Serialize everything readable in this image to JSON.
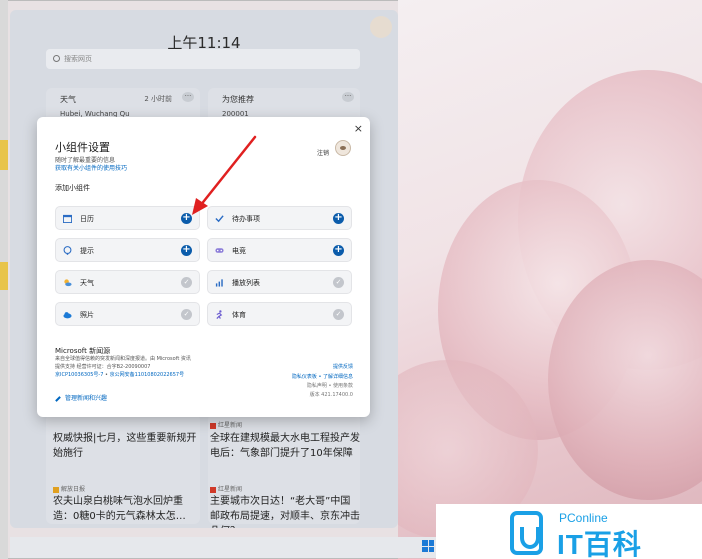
{
  "panel": {
    "clock": "上午11:14",
    "search_placeholder": "搜索网页",
    "weather_card": {
      "title": "天气",
      "meta": "2 小时前",
      "location": "Hubei, Wuchang Qu"
    },
    "recommend_card": {
      "title": "为您推荐",
      "meta": "200001"
    },
    "news": [
      {
        "text": "权威快报|七月，这些重要新规开始施行",
        "source": ""
      },
      {
        "source": "红星新闻",
        "text": "全球在建规模最大水电工程投产发电后：气象部门提升了10年保障"
      },
      {
        "source": "解放日报",
        "text": "农夫山泉白桃味气泡水回炉重造：0糖0卡的元气森林太怎…"
      },
      {
        "source": "红星新闻",
        "text": "主要城市次日达！“老大哥”中国邮政布局提速，对顺丰、京东冲击几何？"
      }
    ]
  },
  "dialog": {
    "title": "小组件设置",
    "description": "随时了解最重要的信息",
    "tips_link": "获取有关小组件的使用技巧",
    "signout": "注销",
    "add_widgets_label": "添加小组件",
    "close_glyph": "×",
    "widgets": [
      {
        "label": "日历",
        "state": "add",
        "icon": "calendar-icon"
      },
      {
        "label": "待办事项",
        "state": "add",
        "icon": "checkmark-icon"
      },
      {
        "label": "提示",
        "state": "add",
        "icon": "tips-icon"
      },
      {
        "label": "电竞",
        "state": "add",
        "icon": "gamepad-icon"
      },
      {
        "label": "天气",
        "state": "added",
        "icon": "weather-icon"
      },
      {
        "label": "播放列表",
        "state": "added",
        "icon": "chart-icon"
      },
      {
        "label": "照片",
        "state": "added",
        "icon": "cloud-icon"
      },
      {
        "label": "体育",
        "state": "added",
        "icon": "runner-icon"
      }
    ],
    "add_glyph": "+",
    "added_glyph": "✓",
    "microsoft": {
      "title": "Microsoft 新闻源",
      "line1": "来自全球值得信赖的突发新闻和深度报道。由 Microsoft 资讯",
      "line2": "提供支持 经营许可证：合字B2-20090007",
      "icp": "京ICP10036305号-7",
      "gongan": "京公网安备11010802022657号",
      "feedback": "提供反馈",
      "privacy": "隐私仪表板",
      "learn": "了解详细信息",
      "privacy_statement": "隐私声明",
      "terms": "使用条款",
      "version": "版本 421.17400.0"
    },
    "manage_link": "管理新闻和兴趣"
  },
  "logo": {
    "top": "PConline",
    "big": "IT百科"
  },
  "colors": {
    "accent": "#0b5cab",
    "link": "#0067c0",
    "arrow": "#e02020",
    "logo": "#1aa0e6"
  }
}
